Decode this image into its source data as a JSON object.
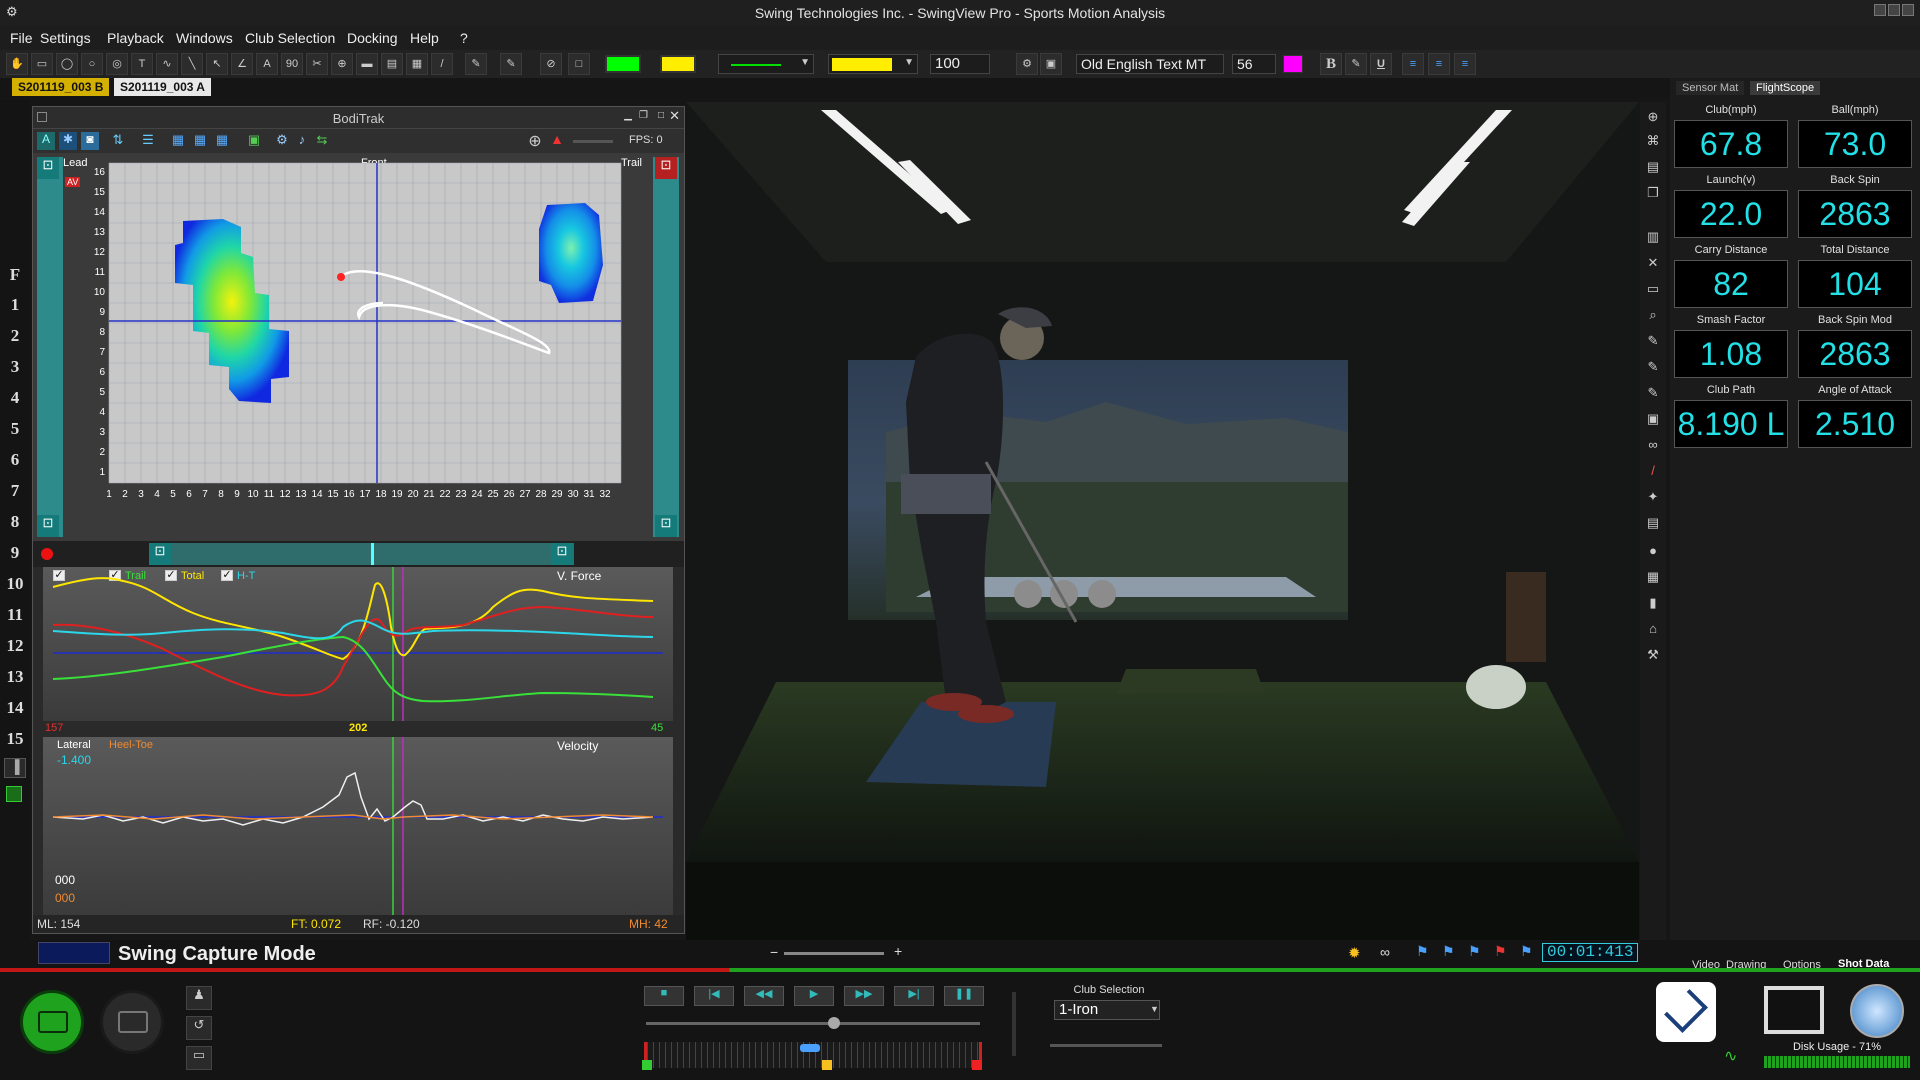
{
  "window": {
    "title": "Swing Technologies Inc. - SwingView Pro - Sports Motion Analysis"
  },
  "menu": [
    "File",
    "Settings",
    "Playback",
    "Windows",
    "Club Selection",
    "Docking",
    "Help",
    "?"
  ],
  "toolbar": {
    "line_width": "100",
    "font_name": "Old English Text MT",
    "font_size": "56",
    "bold": "B",
    "underline": "U"
  },
  "file_tabs": [
    "S201119_003 B",
    "S201119_003 A"
  ],
  "left_rows": [
    "F",
    "1",
    "2",
    "3",
    "4",
    "5",
    "6",
    "7",
    "8",
    "9",
    "10",
    "11",
    "12",
    "13",
    "14",
    "15"
  ],
  "bodi": {
    "title": "BodiTrak",
    "fps": "FPS: 0",
    "lead": "Lead",
    "front": "Front",
    "trail": "Trail",
    "av": "AV",
    "y_ticks": [
      "16",
      "15",
      "14",
      "13",
      "12",
      "11",
      "10",
      "9",
      "8",
      "7",
      "6",
      "5",
      "4",
      "3",
      "2",
      "1"
    ],
    "x_ticks": [
      "1",
      "2",
      "3",
      "4",
      "5",
      "6",
      "7",
      "8",
      "9",
      "10",
      "11",
      "12",
      "13",
      "14",
      "15",
      "16",
      "17",
      "18",
      "19",
      "20",
      "21",
      "22",
      "23",
      "24",
      "25",
      "26",
      "27",
      "28",
      "29",
      "30",
      "31",
      "32"
    ],
    "force": {
      "title": "V. Force",
      "legend": [
        "Trail",
        "Total",
        "H-T"
      ],
      "left_val": "157",
      "mid_val": "202",
      "right_val": "45"
    },
    "velocity": {
      "title": "Velocity",
      "lateral": "Lateral",
      "heel_toe": "Heel-Toe",
      "lateral_val": "-1.400",
      "val1": "000",
      "val2": "000"
    },
    "status": {
      "ml": "ML: 154",
      "ft": "FT: 0.072",
      "rf": "RF: -0.120",
      "mh": "MH: 42"
    }
  },
  "right": {
    "tabs": [
      "Sensor Mat",
      "FlightScope"
    ],
    "metrics": [
      {
        "label": "Club(mph)",
        "value": "67.8"
      },
      {
        "label": "Ball(mph)",
        "value": "73.0"
      },
      {
        "label": "Launch(v)",
        "value": "22.0"
      },
      {
        "label": "Back Spin",
        "value": "2863"
      },
      {
        "label": "Carry Distance",
        "value": "82"
      },
      {
        "label": "Total Distance",
        "value": "104"
      },
      {
        "label": "Smash Factor",
        "value": "1.08"
      },
      {
        "label": "Back Spin Mod",
        "value": "2863"
      },
      {
        "label": "Club Path",
        "value": "8.190 L"
      },
      {
        "label": "Angle of Attack",
        "value": "2.510"
      }
    ]
  },
  "bottom": {
    "mode": "Swing Capture Mode",
    "time": "00:01:413",
    "tabs": [
      "Video",
      "Drawing",
      "Options",
      "Shot Data"
    ],
    "club_selection_label": "Club Selection",
    "club_value": "1-Iron",
    "disk_usage": "Disk Usage - 71%"
  },
  "colors": {
    "accent": "#22e0e6",
    "record": "#1fa31f",
    "yellow": "#ffe600"
  }
}
